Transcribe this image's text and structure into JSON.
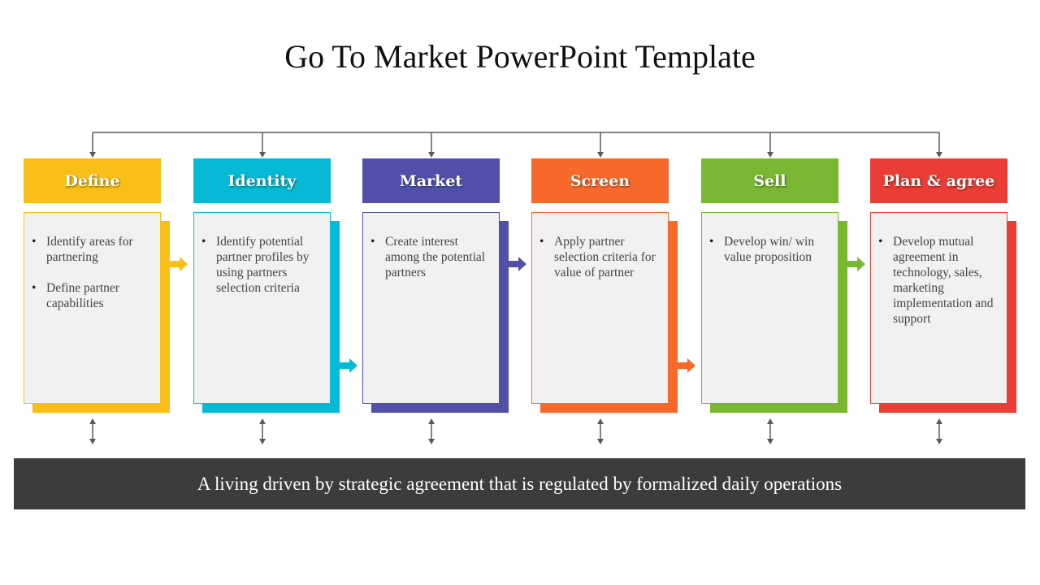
{
  "title": "Go To Market PowerPoint Template",
  "steps": [
    {
      "label": "Define",
      "color": "#F9BE17",
      "bullets": [
        "Identify areas for partnering",
        "Define partner capabilities"
      ],
      "arrow": "top"
    },
    {
      "label": "Identity",
      "color": "#06B9D5",
      "bullets": [
        "Identify potential partner profiles by using partners selection criteria"
      ],
      "arrow": "bottom"
    },
    {
      "label": "Market",
      "color": "#5050A8",
      "bullets": [
        "Create interest among the potential partners"
      ],
      "arrow": "top"
    },
    {
      "label": "Screen",
      "color": "#F6692A",
      "bullets": [
        "Apply partner selection criteria for value of partner"
      ],
      "arrow": "bottom"
    },
    {
      "label": "Sell",
      "color": "#7AB733",
      "bullets": [
        "Develop win/ win value proposition"
      ],
      "arrow": "top"
    },
    {
      "label": "Plan & agree",
      "color": "#EA3D35",
      "bullets": [
        "Develop mutual agreement in technology, sales, marketing implementation and support"
      ],
      "arrow": "none"
    }
  ],
  "footer": "A living driven by strategic agreement that is regulated by formalized daily operations",
  "colors": {
    "connector": "#5a5a5a",
    "footer_bg": "#3c3c3c"
  }
}
